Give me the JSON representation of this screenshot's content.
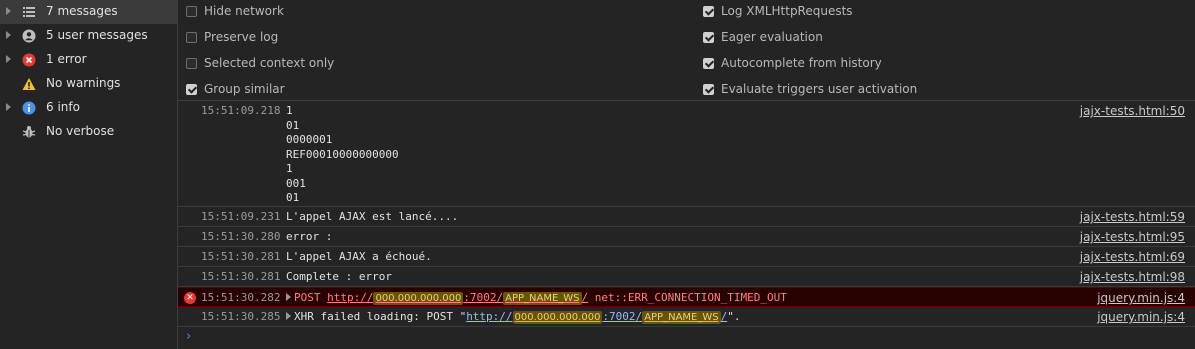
{
  "sidebar": {
    "items": [
      {
        "label": "7 messages",
        "icon": "list-icon"
      },
      {
        "label": "5 user messages",
        "icon": "user-icon"
      },
      {
        "label": "1 error",
        "icon": "error-icon"
      },
      {
        "label": "No warnings",
        "icon": "warning-icon"
      },
      {
        "label": "6 info",
        "icon": "info-icon"
      },
      {
        "label": "No verbose",
        "icon": "bug-icon"
      }
    ]
  },
  "settings": {
    "left": [
      {
        "label": "Hide network",
        "checked": false
      },
      {
        "label": "Preserve log",
        "checked": false
      },
      {
        "label": "Selected context only",
        "checked": false
      },
      {
        "label": "Group similar",
        "checked": true
      }
    ],
    "right": [
      {
        "label": "Log XMLHttpRequests",
        "checked": true
      },
      {
        "label": "Eager evaluation",
        "checked": true
      },
      {
        "label": "Autocomplete from history",
        "checked": true
      },
      {
        "label": "Evaluate triggers user activation",
        "checked": true
      }
    ]
  },
  "console": {
    "rows": [
      {
        "time": "15:51:09.218",
        "lines": [
          "1",
          "01",
          "0000001",
          "REF00010000000000",
          "1",
          "001",
          "01"
        ],
        "source": "jajx-tests.html:50"
      },
      {
        "time": "15:51:09.231",
        "text": "L'appel AJAX est lancé....",
        "source": "jajx-tests.html:59"
      },
      {
        "time": "15:51:30.280",
        "text": "error :",
        "source": "jajx-tests.html:95"
      },
      {
        "time": "15:51:30.281",
        "text": "L'appel AJAX a échoué.",
        "source": "jajx-tests.html:69"
      },
      {
        "time": "15:51:30.281",
        "text": "Complete : error",
        "source": "jajx-tests.html:98"
      },
      {
        "time": "15:51:30.282",
        "method": "POST",
        "url_prefix": "http://",
        "ip": "000.000.000.000",
        "port_path": ":7002/",
        "app": "APP_NAME_WS",
        "url_suffix": "/",
        "error": "net::ERR_CONNECTION_TIMED_OUT",
        "source": "jquery.min.js:4"
      },
      {
        "time": "15:51:30.285",
        "text_prefix": "XHR failed loading: POST \"",
        "url_prefix": "http://",
        "ip": "000.000.000.000",
        "port_path": ":7002/",
        "app": "APP_NAME_WS",
        "url_suffix": "/",
        "text_suffix": "\".",
        "source": "jquery.min.js:4"
      }
    ],
    "prompt": "›"
  }
}
